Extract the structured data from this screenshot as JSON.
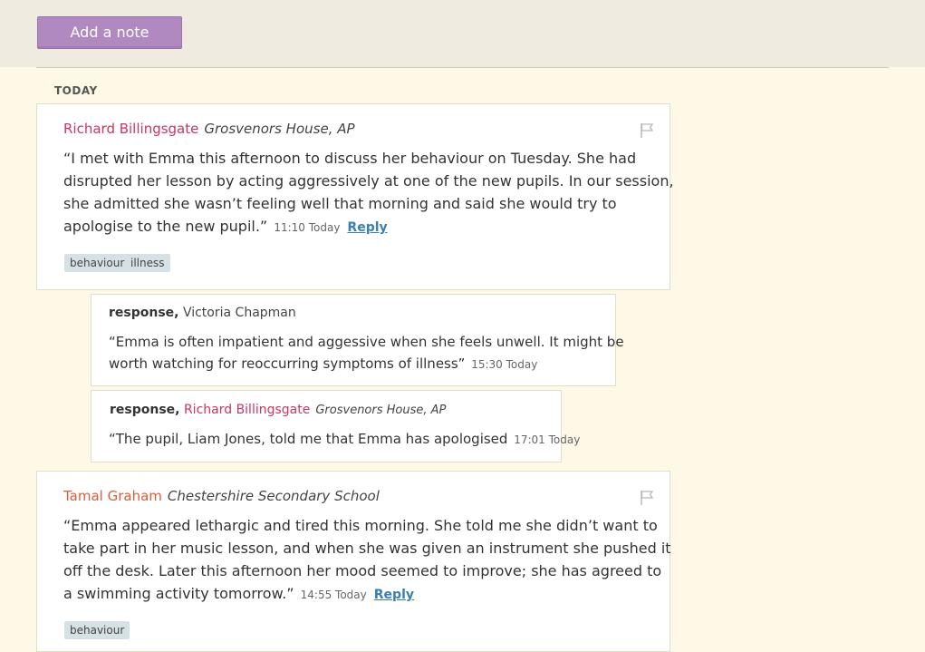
{
  "header": {
    "add_note_label": "Add a note"
  },
  "section": {
    "label": "TODAY"
  },
  "notes": [
    {
      "author": "Richard Billingsgate",
      "org": "Grosvenors House, AP",
      "lines": [
        "“I met with Emma this afternoon to discuss her behaviour on Tuesday. She had",
        "disrupted her lesson by acting aggressively at one of the new pupils. In our session,",
        "she admitted she wasn’t feeling well that morning and said she would try to",
        "apologise to the new pupil.”"
      ],
      "time": "11:10 Today",
      "reply_label": "Reply",
      "tags": [
        "behaviour",
        "illness"
      ],
      "responses": [
        {
          "prefix": "response,",
          "author": "Victoria Chapman",
          "org": "",
          "lines": [
            "“Emma is often impatient and aggessive when she feels unwell. It might be",
            "worth watching for reoccurring symptoms of illness”"
          ],
          "time": "15:30 Today"
        },
        {
          "prefix": "response,",
          "author": "Richard Billingsgate",
          "org": "Grosvenors House, AP",
          "lines": [
            "“The pupil, Liam Jones, told me that Emma has apologised"
          ],
          "time": "17:01 Today"
        }
      ]
    },
    {
      "author": "Tamal Graham",
      "org": "Chestershire Secondary School",
      "lines": [
        "“Emma appeared lethargic and tired this morning. She told me she didn’t want to",
        "take part in her music lesson, and when she was given an instrument she pushed it",
        "off the desk. Later this afternoon her mood seemed to improve; she has agreed to",
        "a swimming activity tomorrow.”"
      ],
      "time": "14:55 Today",
      "reply_label": "Reply",
      "tags": [
        "behaviour"
      ]
    }
  ]
}
